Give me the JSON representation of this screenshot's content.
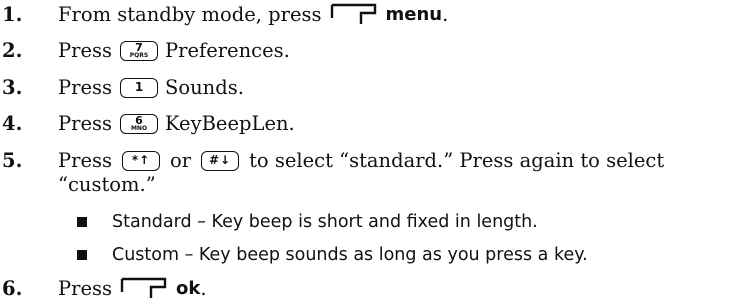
{
  "steps": [
    {
      "num": "1.",
      "pre": "From standby mode, press",
      "post": "menu"
    },
    {
      "num": "2.",
      "pre": "Press",
      "key_digit": "7",
      "key_letters": "PQRS",
      "post": "Preferences."
    },
    {
      "num": "3.",
      "pre": "Press",
      "key_digit": "1",
      "post": "Sounds."
    },
    {
      "num": "4.",
      "pre": "Press",
      "key_digit": "6",
      "key_letters": "MNO",
      "post": "KeyBeepLen."
    },
    {
      "num": "5.",
      "pre": "Press",
      "mid": "or",
      "post": "to select “standard.” Press again to select",
      "cont": "“custom.”"
    },
    {
      "num": "6.",
      "pre": "Press",
      "post": "ok"
    }
  ],
  "step1_period": ".",
  "step6_period": ".",
  "key5a_symbol": "*↑",
  "key5b_symbol": "#↓",
  "bullets": [
    "Standard – Key beep is short and fixed in length.",
    "Custom – Key beep sounds as long as you press a key."
  ],
  "icons": {
    "soft_key": "left-softkey-icon",
    "star_key": "star-up-key-icon",
    "pound_key": "pound-down-message-key-icon"
  }
}
